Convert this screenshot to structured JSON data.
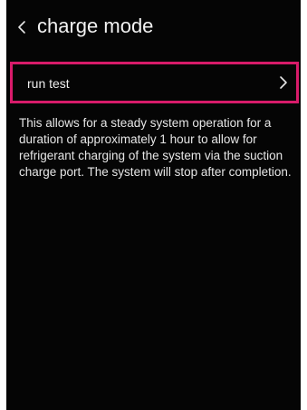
{
  "header": {
    "title": "charge mode",
    "back_icon": "chevron-left-icon"
  },
  "menu": {
    "items": [
      {
        "label": "run test",
        "icon": "chevron-right-icon",
        "selected": true
      }
    ]
  },
  "description": "This allows for a steady system operation for a duration of approximately 1 hour to allow for refrigerant charging of the system via the suction charge port. The system will stop after completion.",
  "colors": {
    "background": "#050505",
    "text": "#f2f2f2",
    "highlight_border": "#d81b6a"
  }
}
